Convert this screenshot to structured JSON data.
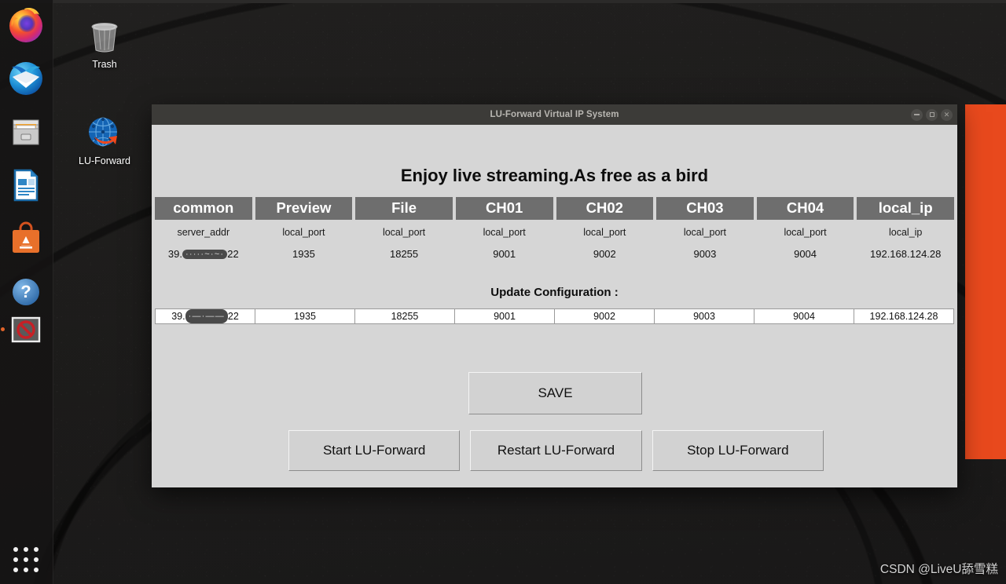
{
  "desktop": {
    "icons": [
      {
        "name": "trash",
        "label": "Trash"
      },
      {
        "name": "lu-forward",
        "label": "LU-Forward"
      }
    ],
    "dock_items": [
      {
        "name": "firefox",
        "label": "Firefox"
      },
      {
        "name": "thunderbird",
        "label": "Thunderbird Mail"
      },
      {
        "name": "files",
        "label": "Files"
      },
      {
        "name": "libreoffice-writer",
        "label": "LibreOffice Writer"
      },
      {
        "name": "ubuntu-software",
        "label": "Ubuntu Software"
      },
      {
        "name": "help",
        "label": "Help"
      },
      {
        "name": "blocked-app",
        "label": "LU-Forward Virtual IP System"
      }
    ],
    "show_applications_label": "Show Applications",
    "watermark": "CSDN @LiveU舔雪糕"
  },
  "window": {
    "title": "LU-Forward Virtual IP System",
    "controls": {
      "minimize": "minimize-button",
      "maximize": "maximize-button",
      "close": "close-button"
    },
    "headline": "Enjoy live streaming.As free as a bird",
    "table": {
      "headers": [
        "common",
        "Preview",
        "File",
        "CH01",
        "CH02",
        "CH03",
        "CH04",
        "local_ip"
      ],
      "subheaders": [
        "server_addr",
        "local_port",
        "local_port",
        "local_port",
        "local_port",
        "local_port",
        "local_port",
        "local_ip"
      ],
      "values": [
        {
          "prefix": "39.",
          "redacted": "·····~·~·",
          "suffix": "22"
        },
        {
          "text": "1935"
        },
        {
          "text": "18255"
        },
        {
          "text": "9001"
        },
        {
          "text": "9002"
        },
        {
          "text": "9003"
        },
        {
          "text": "9004"
        },
        {
          "text": "192.168.124.28"
        }
      ]
    },
    "update_section": {
      "label": "Update Configuration :",
      "fields": [
        {
          "name": "server-addr-input",
          "prefix": "39.",
          "redacted": "·—·——",
          "suffix": "22"
        },
        {
          "name": "preview-local-port-input",
          "value": "1935"
        },
        {
          "name": "file-local-port-input",
          "value": "18255"
        },
        {
          "name": "ch01-local-port-input",
          "value": "9001"
        },
        {
          "name": "ch02-local-port-input",
          "value": "9002"
        },
        {
          "name": "ch03-local-port-input",
          "value": "9003"
        },
        {
          "name": "ch04-local-port-input",
          "value": "9004"
        },
        {
          "name": "local-ip-input",
          "value": "192.168.124.28"
        }
      ]
    },
    "buttons": {
      "save": "SAVE",
      "start": "Start LU-Forward",
      "restart": "Restart LU-Forward",
      "stop": "Stop LU-Forward"
    }
  },
  "colors": {
    "accent_orange": "#e8491d",
    "header_gray": "#6e6e6e",
    "window_bg": "#d6d6d6",
    "titlebar": "#3c3b38"
  }
}
